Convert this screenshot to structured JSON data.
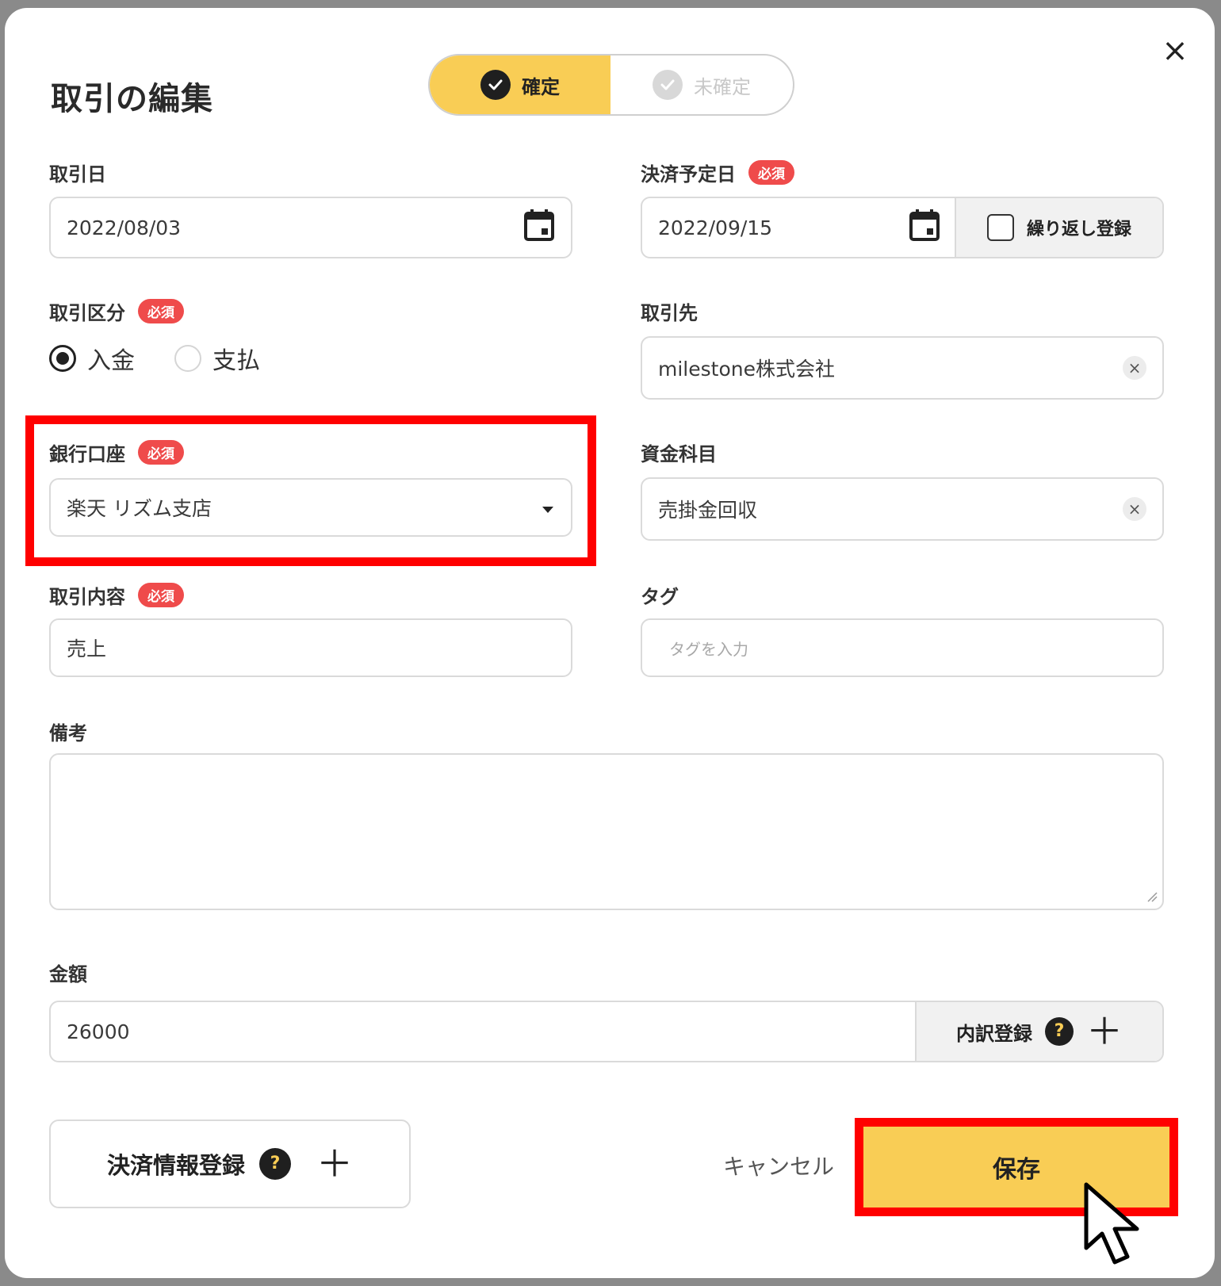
{
  "dialog": {
    "title": "取引の編集",
    "close_icon": "×"
  },
  "status_toggle": {
    "confirmed_label": "確定",
    "unconfirmed_label": "未確定",
    "selected": "確定"
  },
  "required_badge": "必須",
  "fields": {
    "transaction_date": {
      "label": "取引日",
      "value": "2022/08/03",
      "icon": "calendar-icon"
    },
    "due_date": {
      "label": "決済予定日",
      "value": "2022/09/15",
      "icon": "calendar-icon",
      "recurring_label": "繰り返し登録",
      "recurring_checked": false
    },
    "type": {
      "label": "取引区分",
      "options": [
        "入金",
        "支払"
      ],
      "selected": "入金"
    },
    "partner": {
      "label": "取引先",
      "value": "milestone株式会社"
    },
    "bank_account": {
      "label": "銀行口座",
      "value": "楽天 リズム支店"
    },
    "fund_item": {
      "label": "資金科目",
      "value": "売掛金回収"
    },
    "description": {
      "label": "取引内容",
      "value": "売上"
    },
    "tags": {
      "label": "タグ",
      "placeholder": "タグを入力"
    },
    "notes": {
      "label": "備考",
      "value": ""
    },
    "amount": {
      "label": "金額",
      "value": "26000",
      "breakdown_label": "内訳登録"
    }
  },
  "footer": {
    "payment_info_label": "決済情報登録",
    "cancel_label": "キャンセル",
    "save_label": "保存"
  },
  "help_glyph": "?",
  "plus_glyph": "＋",
  "colors": {
    "accent": "#f9cd55",
    "required": "#ef4b4b",
    "highlight": "#ff0000"
  }
}
